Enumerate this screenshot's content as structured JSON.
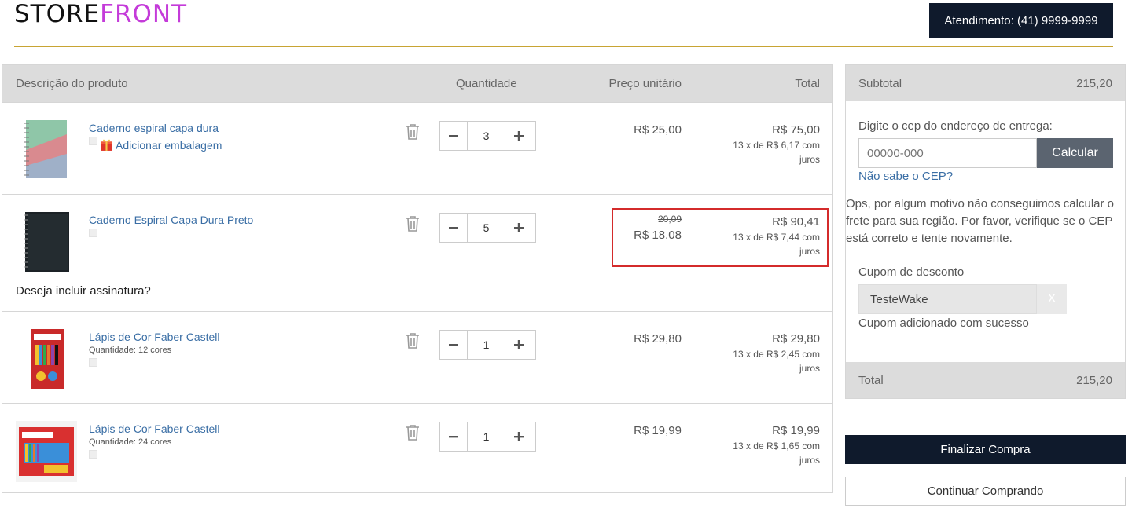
{
  "header": {
    "logo_part1": "STORE",
    "logo_part2": "FRONT",
    "phone_label": "Atendimento: (41) 9999-9999"
  },
  "cart": {
    "columns": {
      "description": "Descrição do produto",
      "quantity": "Quantidade",
      "unit_price": "Preço unitário",
      "total": "Total"
    },
    "items": [
      {
        "name": "Caderno espiral capa dura",
        "gift_label": "Adicionar embalagem",
        "quantity": "3",
        "unit_price": "R$ 25,00",
        "total": "R$ 75,00",
        "installments": "13 x de R$ 6,17 com juros"
      },
      {
        "name": "Caderno Espiral Capa Dura Preto",
        "quantity": "5",
        "old_price": "20,09",
        "unit_price": "R$ 18,08",
        "total": "R$ 90,41",
        "installments": "13 x de R$ 7,44 com juros",
        "subscription_prompt": "Deseja incluir assinatura?"
      },
      {
        "name": "Lápis de Cor Faber Castell",
        "variant": "Quantidade: 12 cores",
        "quantity": "1",
        "unit_price": "R$ 29,80",
        "total": "R$ 29,80",
        "installments": "13 x de R$ 2,45 com juros"
      },
      {
        "name": "Lápis de Cor Faber Castell",
        "variant": "Quantidade: 24 cores",
        "quantity": "1",
        "unit_price": "R$ 19,99",
        "total": "R$ 19,99",
        "installments": "13 x de R$ 1,65 com juros"
      }
    ]
  },
  "summary": {
    "subtotal_label": "Subtotal",
    "subtotal_value": "215,20",
    "cep_label": "Digite o cep do endereço de entrega:",
    "cep_placeholder": "00000-000",
    "cep_button": "Calcular",
    "cep_help_link": "Não sabe o CEP?",
    "cep_error": "Ops, por algum motivo não conseguimos calcular o frete para sua região. Por favor, verifique se o CEP está correto e tente novamente.",
    "coupon_label": "Cupom de desconto",
    "coupon_value": "TesteWake",
    "coupon_remove": "X",
    "coupon_success": "Cupom adicionado com sucesso",
    "total_label": "Total",
    "total_value": "215,20"
  },
  "actions": {
    "finish": "Finalizar Compra",
    "continue": "Continuar Comprando"
  },
  "colors": {
    "brand_dark": "#0f1a2c",
    "logo_accent": "#c43bd9",
    "header_rule": "#c8a433",
    "link": "#3a6ea5",
    "highlight_border": "#d42b2b"
  },
  "icons": {
    "trash": "trash-icon",
    "minus": "minus-icon",
    "plus": "plus-icon",
    "gift": "gift-icon"
  }
}
